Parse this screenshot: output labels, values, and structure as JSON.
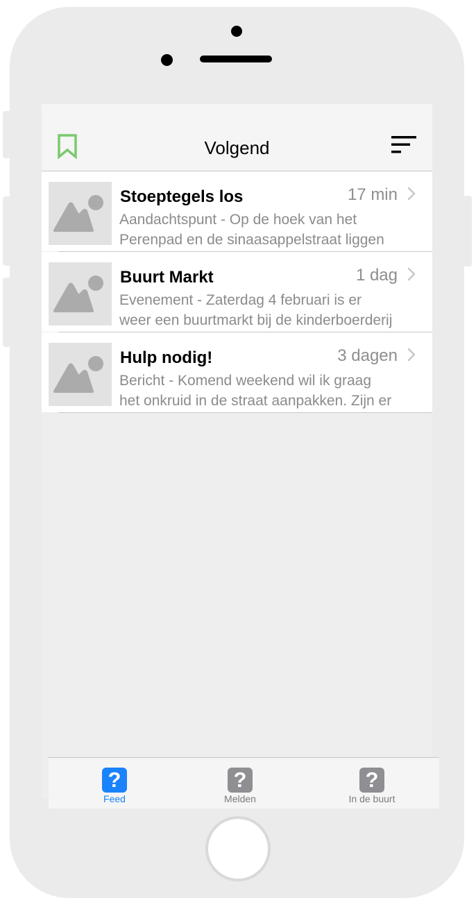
{
  "navbar": {
    "title": "Volgend",
    "bookmark_icon": "bookmark-icon",
    "filter_icon": "sort-icon",
    "accent_color": "#7bc96f"
  },
  "feed": [
    {
      "title": "Stoeptegels los",
      "time": "17 min",
      "line1": "Aandachtspunt - Op de hoek van het",
      "line2": "Perenpad en de sinaasappelstraat liggen"
    },
    {
      "title": "Buurt Markt",
      "time": "1 dag",
      "line1": "Evenement - Zaterdag 4 februari is er",
      "line2": "weer een buurtmarkt bij de kinderboerderij"
    },
    {
      "title": "Hulp nodig!",
      "time": "3 dagen",
      "line1": "Bericht - Komend weekend wil ik graag",
      "line2": "het onkruid in de straat aanpakken. Zijn er"
    }
  ],
  "tabs": [
    {
      "label": "Feed",
      "icon": "?",
      "active": true,
      "color": "#1a82fb"
    },
    {
      "label": "Melden",
      "icon": "?",
      "active": false,
      "color": "#8e8e93"
    },
    {
      "label": "In de buurt",
      "icon": "?",
      "active": false,
      "color": "#8e8e93"
    }
  ]
}
